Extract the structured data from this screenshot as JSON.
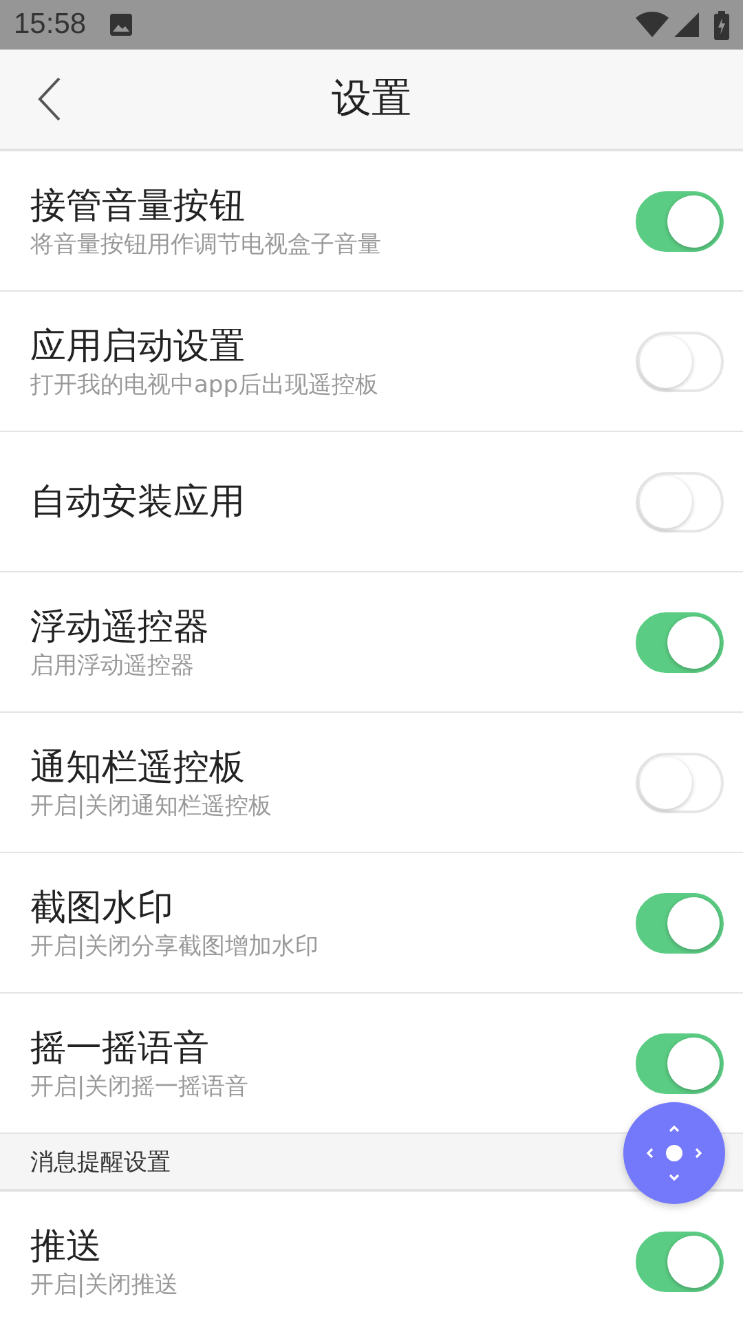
{
  "status_bar": {
    "time": "15:58"
  },
  "header": {
    "title": "设置"
  },
  "items": [
    {
      "kind": "toggle",
      "title": "接管音量按钮",
      "subtitle": "将音量按钮用作调节电视盒子音量",
      "on": true
    },
    {
      "kind": "toggle",
      "title": "应用启动设置",
      "subtitle": "打开我的电视中app后出现遥控板",
      "on": false
    },
    {
      "kind": "toggle",
      "title": "自动安装应用",
      "on": false
    },
    {
      "kind": "toggle",
      "title": "浮动遥控器",
      "subtitle": "启用浮动遥控器",
      "on": true
    },
    {
      "kind": "toggle",
      "title": "通知栏遥控板",
      "subtitle": "开启|关闭通知栏遥控板",
      "on": false
    },
    {
      "kind": "toggle",
      "title": "截图水印",
      "subtitle": "开启|关闭分享截图增加水印",
      "on": true
    },
    {
      "kind": "toggle",
      "title": "摇一摇语音",
      "subtitle": "开启|关闭摇一摇语音",
      "on": true
    },
    {
      "kind": "section",
      "title": "消息提醒设置"
    },
    {
      "kind": "toggle",
      "title": "推送",
      "subtitle": "开启|关闭推送",
      "on": true
    }
  ]
}
